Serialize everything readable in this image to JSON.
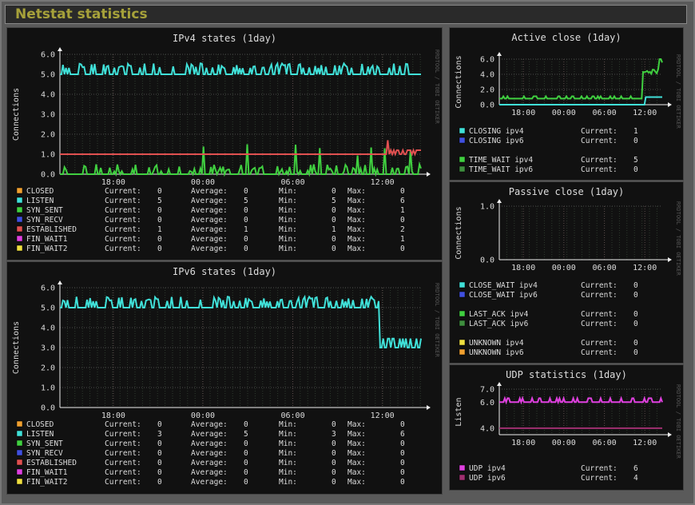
{
  "header": {
    "title": "Netstat statistics"
  },
  "watermark": "RRDTOOL / TOBI OETIKER",
  "chart_data": [
    {
      "id": "ipv4",
      "type": "line",
      "title": "IPv4 states  (1day)",
      "ylabel": "Connections",
      "ylim": [
        0,
        6
      ],
      "yticks": [
        "0.0",
        "1.0",
        "2.0",
        "3.0",
        "4.0",
        "5.0",
        "6.0"
      ],
      "xticks": [
        "18:00",
        "00:00",
        "06:00",
        "12:00"
      ],
      "grid": true,
      "legend_stat_labels": [
        "Current:",
        "Average:",
        "Min:",
        "Max:"
      ],
      "series": [
        {
          "name": "CLOSED",
          "color": "#f0a030",
          "stats": [
            "0",
            "0",
            "0",
            "0"
          ]
        },
        {
          "name": "LISTEN",
          "color": "#40e0d8",
          "stats": [
            "5",
            "5",
            "5",
            "6"
          ]
        },
        {
          "name": "SYN_SENT",
          "color": "#40d040",
          "stats": [
            "0",
            "0",
            "0",
            "1"
          ]
        },
        {
          "name": "SYN_RECV",
          "color": "#4050e0",
          "stats": [
            "0",
            "0",
            "0",
            "0"
          ]
        },
        {
          "name": "ESTABLISHED",
          "color": "#e05050",
          "stats": [
            "1",
            "1",
            "1",
            "2"
          ]
        },
        {
          "name": "FIN_WAIT1",
          "color": "#e040e0",
          "stats": [
            "0",
            "0",
            "0",
            "1"
          ]
        },
        {
          "name": "FIN_WAIT2",
          "color": "#f0e040",
          "stats": [
            "0",
            "0",
            "0",
            "0"
          ]
        }
      ]
    },
    {
      "id": "ipv6",
      "type": "line",
      "title": "IPv6 states  (1day)",
      "ylabel": "Connections",
      "ylim": [
        0,
        6
      ],
      "yticks": [
        "0.0",
        "1.0",
        "2.0",
        "3.0",
        "4.0",
        "5.0",
        "6.0"
      ],
      "xticks": [
        "18:00",
        "00:00",
        "06:00",
        "12:00"
      ],
      "grid": true,
      "legend_stat_labels": [
        "Current:",
        "Average:",
        "Min:",
        "Max:"
      ],
      "series": [
        {
          "name": "CLOSED",
          "color": "#f0a030",
          "stats": [
            "0",
            "0",
            "0",
            "0"
          ]
        },
        {
          "name": "LISTEN",
          "color": "#40e0d8",
          "stats": [
            "3",
            "5",
            "3",
            "6"
          ]
        },
        {
          "name": "SYN_SENT",
          "color": "#40d040",
          "stats": [
            "0",
            "0",
            "0",
            "0"
          ]
        },
        {
          "name": "SYN_RECV",
          "color": "#4050e0",
          "stats": [
            "0",
            "0",
            "0",
            "0"
          ]
        },
        {
          "name": "ESTABLISHED",
          "color": "#e05050",
          "stats": [
            "0",
            "0",
            "0",
            "0"
          ]
        },
        {
          "name": "FIN_WAIT1",
          "color": "#e040e0",
          "stats": [
            "0",
            "0",
            "0",
            "0"
          ]
        },
        {
          "name": "FIN_WAIT2",
          "color": "#f0e040",
          "stats": [
            "0",
            "0",
            "0",
            "0"
          ]
        }
      ]
    },
    {
      "id": "active",
      "type": "line",
      "title": "Active close  (1day)",
      "ylabel": "Connections",
      "ylim": [
        0,
        6
      ],
      "yticks": [
        "0.0",
        "2.0",
        "4.0",
        "6.0"
      ],
      "xticks": [
        "18:00",
        "00:00",
        "06:00",
        "12:00"
      ],
      "grid": true,
      "legend_stat_labels": [
        "Current:"
      ],
      "series": [
        {
          "name": "CLOSING ipv4",
          "color": "#40e0d8",
          "stats": [
            "1"
          ]
        },
        {
          "name": "CLOSING ipv6",
          "color": "#4050e0",
          "stats": [
            "0"
          ]
        },
        {
          "name": "TIME_WAIT ipv4",
          "color": "#40d040",
          "stats": [
            "5"
          ]
        },
        {
          "name": "TIME_WAIT ipv6",
          "color": "#3e8e3e",
          "stats": [
            "0"
          ]
        }
      ]
    },
    {
      "id": "passive",
      "type": "line",
      "title": "Passive close  (1day)",
      "ylabel": "Connections",
      "ylim": [
        0,
        1
      ],
      "yticks": [
        "0.0",
        "1.0"
      ],
      "xticks": [
        "18:00",
        "00:00",
        "06:00",
        "12:00"
      ],
      "grid": true,
      "legend_stat_labels": [
        "Current:"
      ],
      "series": [
        {
          "name": "CLOSE_WAIT ipv4",
          "color": "#40e0d8",
          "stats": [
            "0"
          ]
        },
        {
          "name": "CLOSE_WAIT ipv6",
          "color": "#4050e0",
          "stats": [
            "0"
          ]
        },
        {
          "name": "LAST_ACK ipv4",
          "color": "#40d040",
          "stats": [
            "0"
          ]
        },
        {
          "name": "LAST_ACK ipv6",
          "color": "#3e8e3e",
          "stats": [
            "0"
          ]
        },
        {
          "name": "UNKNOWN ipv4",
          "color": "#f0e040",
          "stats": [
            "0"
          ]
        },
        {
          "name": "UNKNOWN ipv6",
          "color": "#f0a030",
          "stats": [
            "0"
          ]
        }
      ]
    },
    {
      "id": "udp",
      "type": "line",
      "title": "UDP statistics  (1day)",
      "ylabel": "Listen",
      "ylim": [
        3.5,
        7
      ],
      "yticks": [
        "4.0",
        "6.0",
        "7.0"
      ],
      "xticks": [
        "18:00",
        "00:00",
        "06:00",
        "12:00"
      ],
      "grid": true,
      "legend_stat_labels": [
        "Current:"
      ],
      "series": [
        {
          "name": "UDP ipv4",
          "color": "#e040e0",
          "stats": [
            "6"
          ]
        },
        {
          "name": "UDP ipv6",
          "color": "#a03070",
          "stats": [
            "4"
          ]
        }
      ]
    }
  ]
}
